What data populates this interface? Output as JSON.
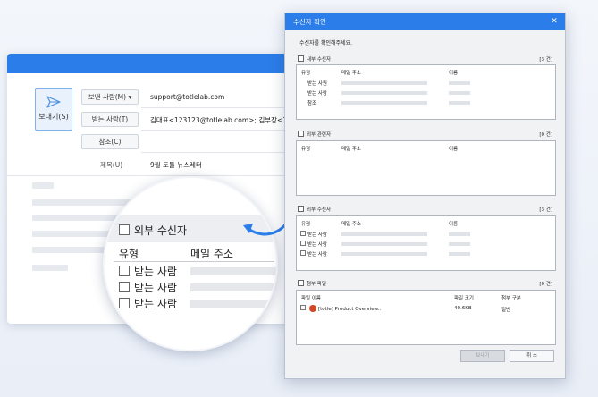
{
  "compose": {
    "send_label": "보내기(S)",
    "sender_button": "보낸 사람(M) ▾",
    "sender_value": "support@totlelab.com",
    "to_button": "받는 사람(T)",
    "to_value": "김대표<123123@totlelab.com>; 김부장<123",
    "cc_button": "참조(C)",
    "subject_label": "제목(U)",
    "subject_value": "9월 토틀 뉴스레터"
  },
  "magnifier": {
    "section_title": "외부 수신자",
    "col_type": "유형",
    "col_email": "메일 주소",
    "rows": [
      "받는 사람",
      "받는 사람",
      "받는 사람"
    ]
  },
  "dialog": {
    "title": "수신자 확인",
    "instruction": "수신자를 확인해주세요.",
    "internal": {
      "title": "내부 수신자",
      "count": "[3 건]",
      "col_type": "유형",
      "col_email": "메일 주소",
      "col_name": "이름",
      "rows": [
        "받는 사원",
        "받는 사람",
        "참조"
      ]
    },
    "external_related": {
      "title": "외부 관련자",
      "count": "[0 건]",
      "col_type": "유형",
      "col_email": "메일 주소",
      "col_name": "이름"
    },
    "external": {
      "title": "외부 수신자",
      "count": "[3 건]",
      "col_type": "유형",
      "col_email": "메일 주소",
      "col_name": "이름",
      "rows": [
        "받는 사람",
        "받는 사람",
        "받는 사람"
      ]
    },
    "attachments": {
      "title": "첨부 파일",
      "count": "[0 건]",
      "col_name": "파일 이름",
      "col_size": "파일 크기",
      "col_type": "첨부 구분",
      "file_name": "[totle] Product Overview..",
      "file_size": "40.6KB",
      "file_type": "일반"
    },
    "send_button": "보내기",
    "cancel_button": "취 소"
  },
  "colors": {
    "accent": "#2b7de9",
    "placeholder": "#dfe2e6"
  },
  "icons": {
    "send": "send-icon",
    "close": "close-icon",
    "powerpoint": "powerpoint-icon",
    "arrow": "curved-arrow-icon"
  }
}
